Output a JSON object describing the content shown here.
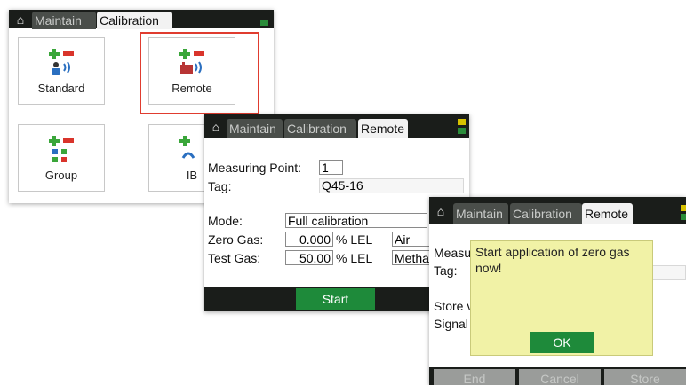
{
  "screen1": {
    "tabs": [
      "Maintain",
      "Calibration"
    ],
    "tiles": [
      {
        "label": "Standard",
        "icon": "standard-calibration-icon"
      },
      {
        "label": "Remote",
        "icon": "remote-calibration-icon"
      },
      {
        "label": "Group",
        "icon": "group-calibration-icon"
      },
      {
        "label": "IB",
        "icon": "ib-calibration-icon"
      }
    ],
    "selected_tile": "Remote",
    "accent_color": "#e03c2f"
  },
  "screen2": {
    "tabs": [
      "Maintain",
      "Calibration",
      "Remote"
    ],
    "measuring_point_label": "Measuring Point:",
    "measuring_point_value": "1",
    "tag_label": "Tag:",
    "tag_value": "Q45-16",
    "mode_label": "Mode:",
    "mode_value": "Full calibration",
    "zero_gas_label": "Zero Gas:",
    "zero_gas_value": "0.000",
    "zero_gas_unit": "% LEL",
    "zero_gas_type": "Air",
    "test_gas_label": "Test Gas:",
    "test_gas_value": "50.00",
    "test_gas_unit": "% LEL",
    "test_gas_type": "Metha",
    "start_button": "Start"
  },
  "screen3": {
    "tabs": [
      "Maintain",
      "Calibration",
      "Remote"
    ],
    "measuring_label_partial": "Measu",
    "tag_label": "Tag:",
    "store_label_partial": "Store v",
    "signal_label_partial": "Signal",
    "dialog_message": "Start application of zero gas now!",
    "ok_button": "OK",
    "footer_buttons": [
      "End",
      "Cancel",
      "Store"
    ]
  },
  "colors": {
    "bar": "#1a1d1a",
    "button_green": "#1e8a3a",
    "dialog_yellow": "#f1f2a6",
    "status_green": "#2a8c3a",
    "status_yellow": "#d8c200"
  }
}
